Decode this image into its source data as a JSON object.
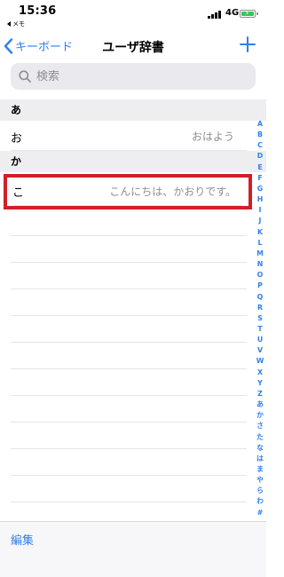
{
  "status_bar": {
    "time": "15:36",
    "back_app": "メモ",
    "network": "4G"
  },
  "nav": {
    "back_label": "キーボード",
    "title": "ユーザ辞書"
  },
  "search": {
    "placeholder": "検索"
  },
  "sections": [
    {
      "header": "あ",
      "rows": [
        {
          "reading": "お",
          "word": "おはよう"
        }
      ]
    },
    {
      "header": "か",
      "rows": [
        {
          "reading": "こ",
          "word": "こんにちは、かおりです。"
        }
      ]
    }
  ],
  "index": [
    "A",
    "B",
    "C",
    "D",
    "E",
    "F",
    "G",
    "H",
    "I",
    "J",
    "K",
    "L",
    "M",
    "N",
    "O",
    "P",
    "Q",
    "R",
    "S",
    "T",
    "U",
    "V",
    "W",
    "X",
    "Y",
    "Z",
    "あ",
    "か",
    "さ",
    "た",
    "な",
    "は",
    "ま",
    "や",
    "ら",
    "わ",
    "#"
  ],
  "toolbar": {
    "edit_label": "編集"
  },
  "colors": {
    "accent": "#2f7ff0",
    "highlight_border": "#d21f26",
    "battery": "#34c759",
    "secondary_text": "#8e8e93"
  }
}
